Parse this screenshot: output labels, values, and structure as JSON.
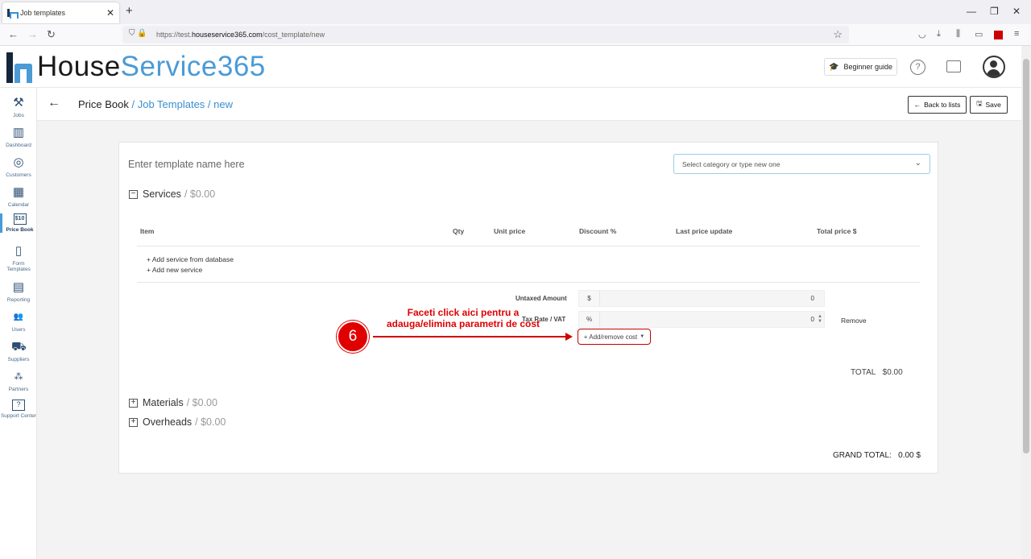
{
  "browser": {
    "tab_title": "Job templates",
    "tab_close": "✕",
    "new_tab": "+",
    "url_prefix": "https://test.",
    "url_domain": "houseservice365.com",
    "url_path": "/cost_template/new"
  },
  "logo": {
    "part1": "House",
    "part2": "Service365"
  },
  "header": {
    "beginner_guide": "Beginner guide",
    "help": "?"
  },
  "sidebar": {
    "items": [
      {
        "label": "Jobs",
        "icon": "tools-icon"
      },
      {
        "label": "Dashboard",
        "icon": "chart-icon"
      },
      {
        "label": "Customers",
        "icon": "target-icon"
      },
      {
        "label": "Calendar",
        "icon": "calendar-icon"
      },
      {
        "label": "Price Book",
        "icon": "price-tag-icon",
        "glyph": "$10"
      },
      {
        "label": "Form Templates",
        "icon": "form-icon"
      },
      {
        "label": "Reporting",
        "icon": "report-icon"
      },
      {
        "label": "Users",
        "icon": "users-icon"
      },
      {
        "label": "Suppliers",
        "icon": "truck-icon"
      },
      {
        "label": "Partners",
        "icon": "network-icon"
      },
      {
        "label": "Support Center",
        "icon": "support-icon",
        "glyph": "?"
      }
    ]
  },
  "breadcrumb": {
    "root": "Price Book",
    "sep1": " / ",
    "section": "Job Templates",
    "sep2": " / ",
    "page": "new"
  },
  "toolbar": {
    "back_label": "Back to lists",
    "save_label": "Save"
  },
  "form": {
    "name_placeholder": "Enter template name here",
    "category_placeholder": "Select category or type new one"
  },
  "services": {
    "title": "Services",
    "amount": "/ $0.00",
    "columns": [
      "Item",
      "Qty",
      "Unit price",
      "Discount %",
      "Last price update",
      "Total price $"
    ],
    "add_from_db": "Add service from database",
    "add_new": "Add new service",
    "untaxed_label": "Untaxed Amount",
    "untaxed_prefix": "$",
    "untaxed_value": "0",
    "tax_label": "Tax Rate / VAT",
    "tax_prefix": "%",
    "tax_value": "0",
    "remove": "Remove",
    "add_remove_cost": "+ Add/remove cost",
    "total_label": "TOTAL",
    "total_value": "$0.00"
  },
  "materials": {
    "title": "Materials",
    "amount": "/ $0.00"
  },
  "overheads": {
    "title": "Overheads",
    "amount": "/ $0.00"
  },
  "grand_total": {
    "label": "GRAND TOTAL:",
    "value": "0.00 $"
  },
  "annotation": {
    "step": "6",
    "line1": "Faceti click aici pentru a",
    "line2": "adauga/elimina parametri de cost"
  }
}
